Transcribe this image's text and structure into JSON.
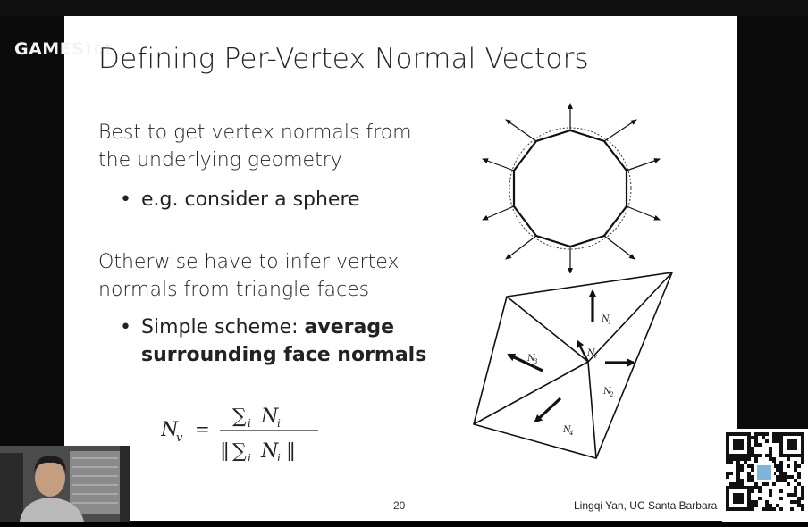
{
  "watermark": {
    "brand": "GAMES",
    "faint_text": "101"
  },
  "slide": {
    "title": "Defining Per-Vertex Normal Vectors",
    "para1_line1": "Best to get vertex normals from",
    "para1_line2": "the underlying geometry",
    "sub1": "e.g. consider a sphere",
    "para2_line1": "Otherwise have to infer vertex",
    "para2_line2": "normals from triangle faces",
    "sub2_normal": "Simple scheme: ",
    "sub2_bold1": "average",
    "sub2_bold2": "surrounding face normals",
    "bullet_glyph": "•",
    "formula": {
      "lhs": "N",
      "lhs_sub": "v",
      "equals": "=",
      "numerator_sum": "∑",
      "sum_sub": "i",
      "var": "N",
      "var_sub": "i",
      "norm_bars": "‖"
    },
    "diagram_labels": {
      "n1": "N",
      "n1_sub": "1",
      "n2": "N",
      "n2_sub": "2",
      "n3": "N",
      "n3_sub": "3",
      "n4": "N",
      "n4_sub": "4",
      "nv": "N",
      "nv_sub": "v"
    },
    "page_number": "20",
    "credit": "Lingqi Yan, UC Santa Barbara"
  },
  "colors": {
    "slide_bg": "#ffffff",
    "text": "#222222",
    "frame_bg": "#0b0b0b"
  }
}
